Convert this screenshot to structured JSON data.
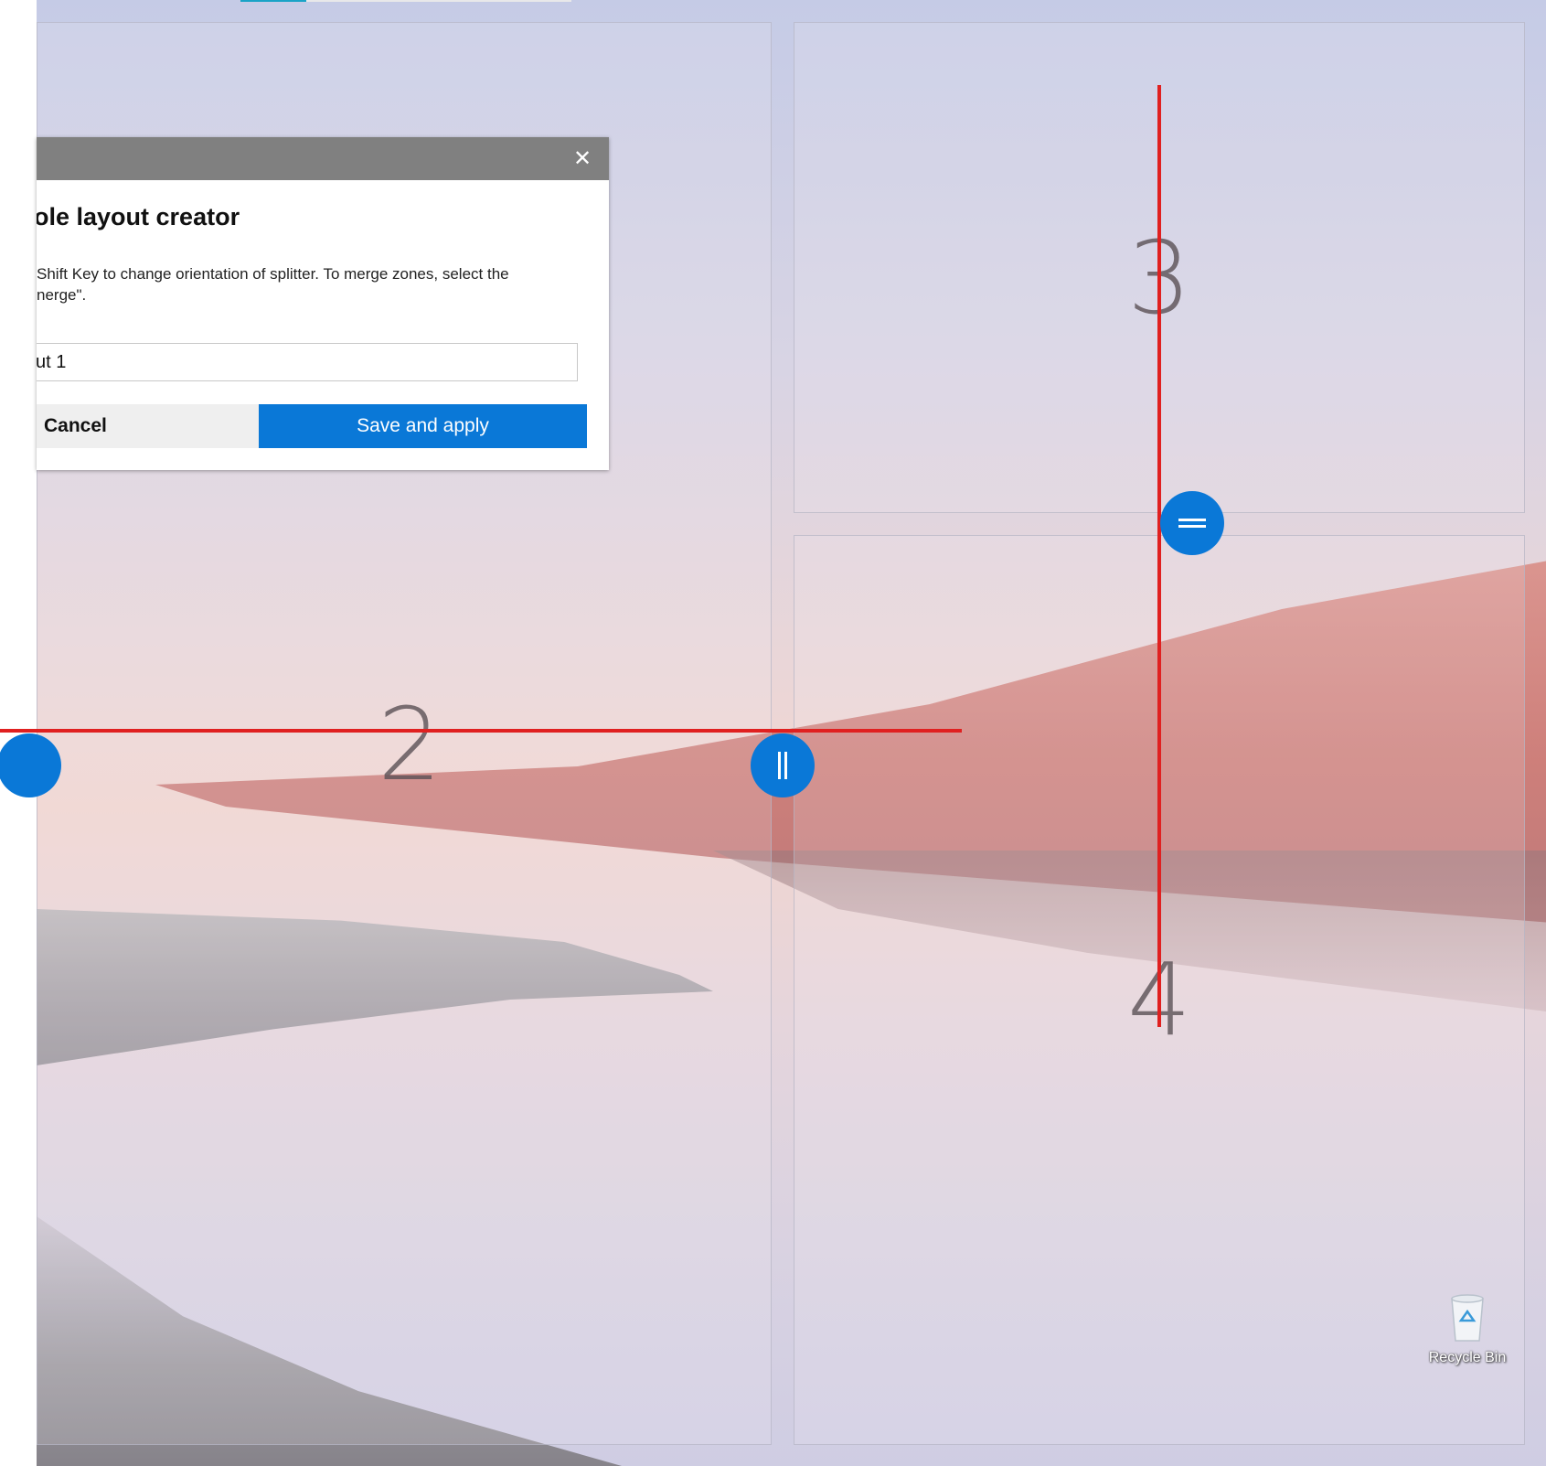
{
  "dialog": {
    "title": "ole layout creator",
    "help_line1": "Shift Key to change orientation of splitter.  To merge zones, select the",
    "help_line2": "nerge\".",
    "layout_name_value": "ut 1",
    "cancel_label": "Cancel",
    "save_label": "Save and apply",
    "close_glyph": "✕"
  },
  "zones": {
    "zone2_number": "2",
    "zone3_number": "3",
    "zone4_number": "4"
  },
  "desktop": {
    "recycle_bin_label": "Recycle Bin"
  },
  "colors": {
    "accent": "#0a78d7",
    "splitter": "#e02020",
    "titlebar": "#808080",
    "top_strip_teal": "#1aa3c7"
  }
}
